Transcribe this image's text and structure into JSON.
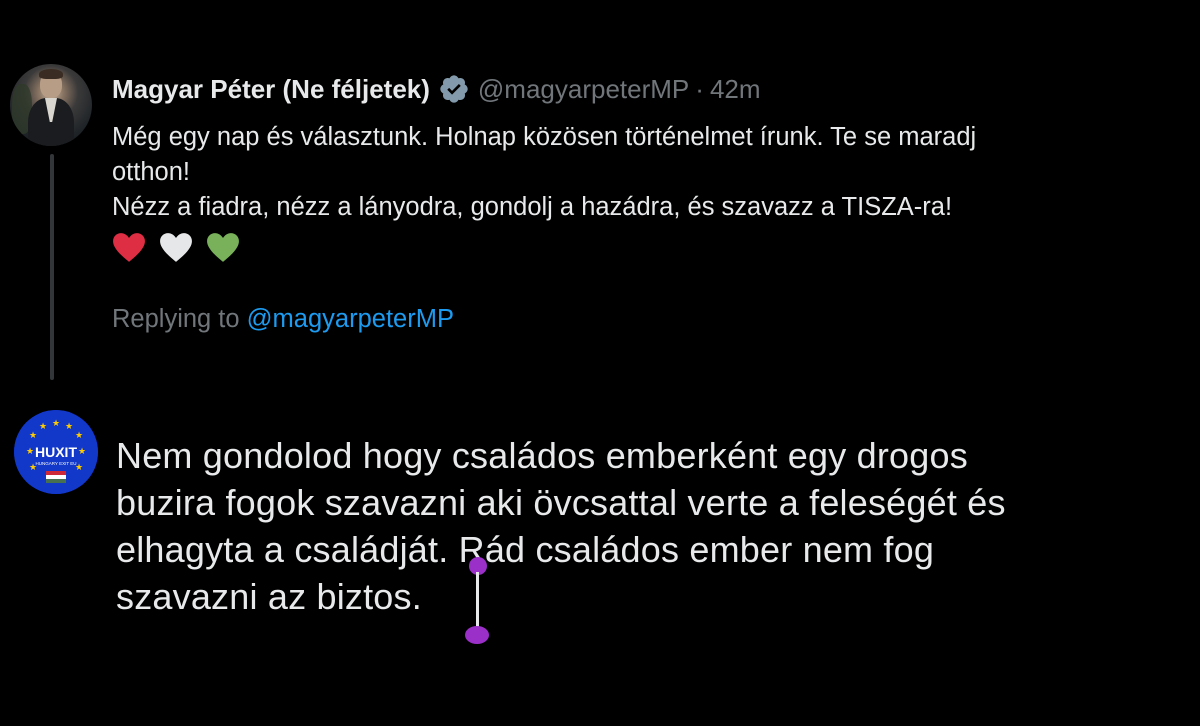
{
  "tweet": {
    "author_name": "Magyar Péter (Ne féljetek)",
    "handle": "@magyarpeterMP",
    "separator": "·",
    "time": "42m",
    "text_line1": "Még egy nap és választunk. Holnap közösen történelmet írunk. Te se maradj",
    "text_line2": "otthon!",
    "text_line3": "Nézz a fiadra, nézz a lányodra, gondolj a hazádra, és szavazz a TISZA-ra!",
    "hearts": [
      "red-heart-icon",
      "white-heart-icon",
      "green-heart-icon"
    ],
    "replying_prefix": "Replying to",
    "replying_handle": "@magyarpeterMP"
  },
  "reply": {
    "avatar_text": "HUXIT",
    "avatar_subtext": "HUNGARY EXIT EU",
    "text_line1": "Nem gondolod hogy családos emberként egy drogos",
    "text_line2": "buzira fogok szavazni aki övcsattal verte a feleségét és",
    "text_line3": "elhagyta a családját. Rád családos ember nem fog",
    "text_line4": "szavazni az biztos."
  },
  "colors": {
    "background": "#000000",
    "text": "#e7e9ea",
    "muted": "#71767b",
    "link": "#1d9bf0",
    "verified": "#829aab",
    "selection_handle": "#9b30c9"
  }
}
